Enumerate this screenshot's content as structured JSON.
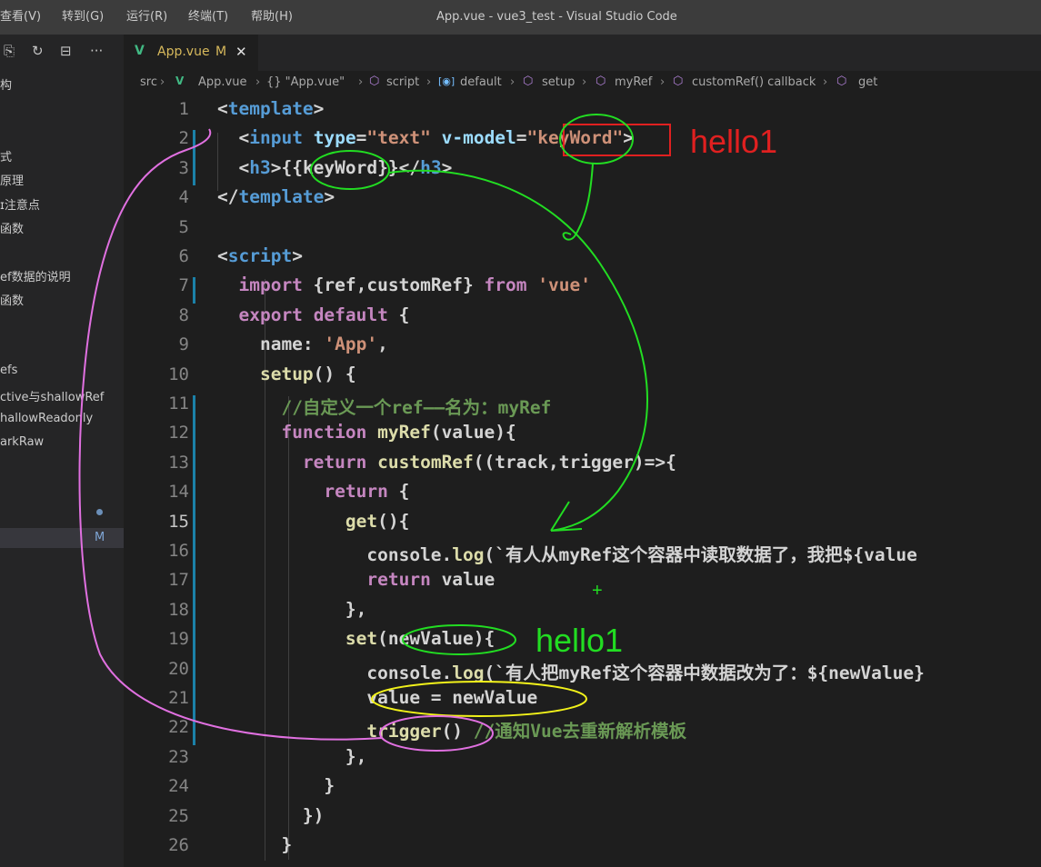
{
  "menu": [
    "查看(V)",
    "转到(G)",
    "运行(R)",
    "终端(T)",
    "帮助(H)"
  ],
  "window_title": "App.vue - vue3_test - Visual Studio Code",
  "sidebar": {
    "more": "···",
    "items": [
      "构",
      "式",
      "原理",
      "ɪ注意点",
      "函数",
      "ef数据的说明",
      "函数",
      "efs",
      "ctive与shallowRef",
      "hallowReadonly",
      "arkRaw"
    ],
    "badge": "M"
  },
  "tab": {
    "icon": "vue-icon",
    "label": "App.vue",
    "badge": "M",
    "close": "✕"
  },
  "breadcrumb": [
    "src",
    "App.vue",
    "{} \"App.vue\"",
    "script",
    "default",
    "setup",
    "myRef",
    "customRef() callback",
    "get"
  ],
  "code": {
    "current_line": 15,
    "lines": [
      {
        "n": "1",
        "t": "<template>"
      },
      {
        "n": "2",
        "t": "  <input type=\"text\" v-model=\"keyWord\">"
      },
      {
        "n": "3",
        "t": "  <h3>{{keyWord}}</h3>"
      },
      {
        "n": "4",
        "t": "</template>"
      },
      {
        "n": "5",
        "t": ""
      },
      {
        "n": "6",
        "t": "<script>"
      },
      {
        "n": "7",
        "t": "  import {ref,customRef} from 'vue'"
      },
      {
        "n": "8",
        "t": "  export default {"
      },
      {
        "n": "9",
        "t": "    name: 'App',"
      },
      {
        "n": "10",
        "t": "    setup() {"
      },
      {
        "n": "11",
        "t": "      //自定义一个ref——名为：myRef"
      },
      {
        "n": "12",
        "t": "      function myRef(value){"
      },
      {
        "n": "13",
        "t": "        return customRef((track,trigger)=>{"
      },
      {
        "n": "14",
        "t": "          return {"
      },
      {
        "n": "15",
        "t": "            get(){"
      },
      {
        "n": "16",
        "t": "              console.log(`有人从myRef这个容器中读取数据了，我把${value"
      },
      {
        "n": "17",
        "t": "              return value"
      },
      {
        "n": "18",
        "t": "            },"
      },
      {
        "n": "19",
        "t": "            set(newValue){"
      },
      {
        "n": "20",
        "t": "              console.log(`有人把myRef这个容器中数据改为了：${newValue}"
      },
      {
        "n": "21",
        "t": "              value = newValue"
      },
      {
        "n": "22",
        "t": "              trigger() //通知Vue去重新解析模板"
      },
      {
        "n": "23",
        "t": "            },"
      },
      {
        "n": "24",
        "t": "          }"
      },
      {
        "n": "25",
        "t": "        })"
      },
      {
        "n": "26",
        "t": "      }"
      }
    ]
  },
  "annotations": {
    "red_label": "hello1",
    "green_label": "hello1",
    "plus": "+"
  },
  "colors": {
    "keyword": "#569cd6",
    "control": "#c586c0",
    "string": "#ce9178",
    "function": "#dcdcaa",
    "variable": "#9cdcfe",
    "comment": "#6a9955",
    "tag": "#569cd6",
    "mod_bar": "#1b81a8",
    "annot_red": "#e02020",
    "annot_green": "#22dd22",
    "annot_yellow": "#f2f21a",
    "annot_pink": "#e070e0"
  }
}
